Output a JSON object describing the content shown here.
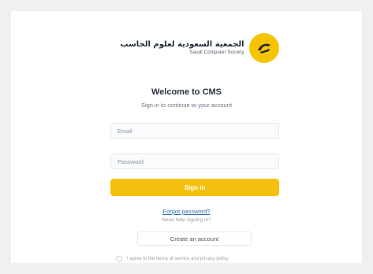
{
  "logo": {
    "arabic_name": "الجمعية السعودية لعلوم الحاسب",
    "english_name": "Saudi Computer Society",
    "icon": "logo-mark-icon",
    "accent": "#f5c400"
  },
  "header": {
    "title": "Welcome to CMS",
    "subtitle": "Sign in to continue to your account"
  },
  "form": {
    "email_placeholder": "Email",
    "password_placeholder": "Password",
    "signin_label": "Sign in",
    "forgot_label": "Forgot password?",
    "help_text": "Need help signing in?",
    "create_label": "Create an account",
    "terms_text": "I agree to the terms of service and privacy policy"
  },
  "colors": {
    "primary": "#f5bf0e",
    "link": "#2b6cb0",
    "background": "#eef0f2"
  }
}
